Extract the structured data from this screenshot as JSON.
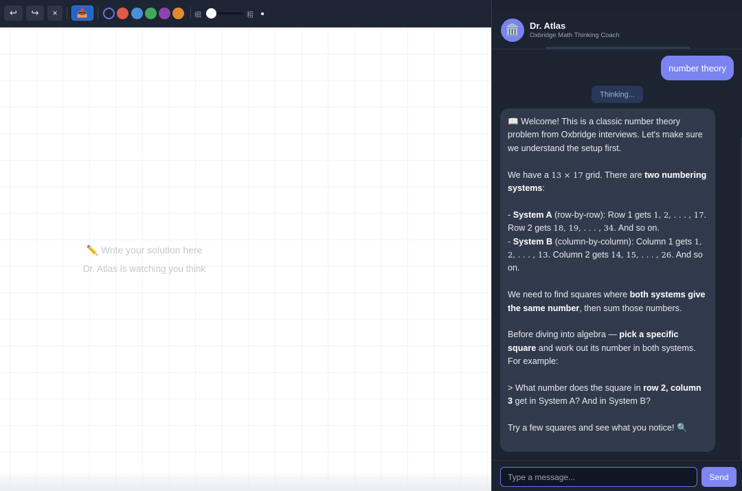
{
  "toolbar": {
    "undo_icon": "↩",
    "redo_icon": "↪",
    "clear_icon": "×",
    "eraser_icon": "📥",
    "colors": [
      "#6b73e0",
      "#e05a4a",
      "#4a90d9",
      "#43a85a",
      "#8e44ad",
      "#e08a2e"
    ],
    "size_thin_label": "细",
    "size_thick_label": "粗",
    "brush_size": 0.1
  },
  "canvas": {
    "placeholder_title": "✏️ Write your solution here",
    "placeholder_subtitle": "Dr. Atlas is watching you think"
  },
  "chat": {
    "avatar_icon": "🏛️",
    "coach_name": "Dr. Atlas",
    "coach_subtitle": "Oxbridge Math Thinking Coach",
    "user_message": "number theory",
    "thinking_label": "Thinking...",
    "bot": {
      "p1": "📖 Welcome! This is a classic number theory problem from Oxbridge interviews. Let's make sure we understand the setup first.",
      "p2_a": "We have a ",
      "p2_math": "13 × 17",
      "p2_b": " grid. There are ",
      "p2_bold": "two numbering systems",
      "p2_c": ":",
      "sysA_prefix": "- ",
      "sysA_bold": "System A",
      "sysA_a": " (row-by-row): Row 1 gets ",
      "sysA_m1": "1, 2, . . . , 17.",
      "sysA_b": " Row 2 gets ",
      "sysA_m2": "18, 19, . . . , 34.",
      "sysA_c": " And so on.",
      "sysB_prefix": "- ",
      "sysB_bold": "System B",
      "sysB_a": " (column-by-column): Column 1 gets ",
      "sysB_m1": "1, 2, . . . , 13.",
      "sysB_b": " Column 2 gets ",
      "sysB_m2": "14, 15, . . . , 26.",
      "sysB_c": " And so on.",
      "p4_a": "We need to find squares where ",
      "p4_bold": "both systems give the same number",
      "p4_b": ", then sum those numbers.",
      "p5_a": "Before diving into algebra — ",
      "p5_bold": "pick a specific square",
      "p5_b": " and work out its number in both systems. For example:",
      "p6_a": "> What number does the square in ",
      "p6_bold": "row 2, column 3",
      "p6_b": " get in System A? And in System B?",
      "p7": "Try a few squares and see what you notice! 🔍"
    },
    "input_placeholder": "Type a message...",
    "send_label": "Send"
  }
}
